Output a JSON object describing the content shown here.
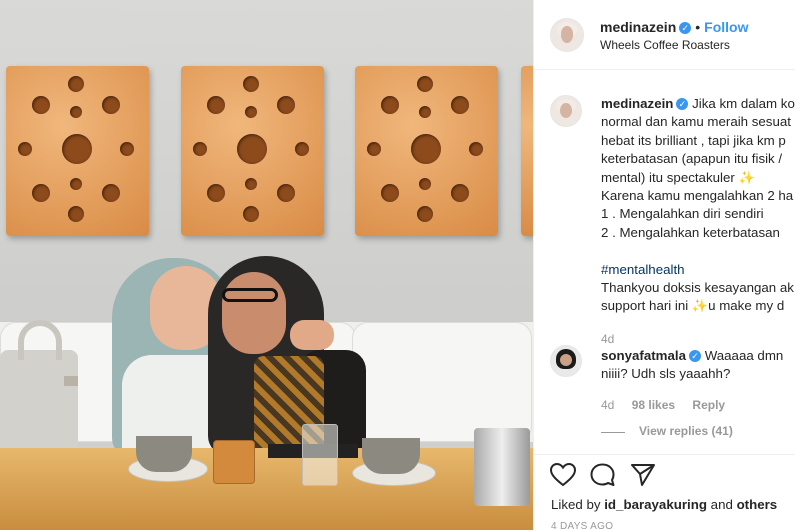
{
  "post": {
    "username": "medinazein",
    "follow_label": "Follow",
    "separator": "•",
    "location": "Wheels Coffee Roasters"
  },
  "caption": {
    "username": "medinazein",
    "lines": [
      "Jika km dalam ko",
      "normal dan kamu meraih sesuat",
      "hebat its brilliant , tapi jika km p",
      "keterbatasan (apapun itu fisik /",
      "mental) itu spectakuler",
      "Karena kamu mengalahkan 2 ha",
      "1 . Mengalahkan diri sendiri",
      "2 . Mengalahkan keterbatasan",
      "",
      "#mentalhealth",
      "Thankyou doksis kesayangan ak",
      "support hari ini",
      "u make my d"
    ],
    "time": "4d"
  },
  "comment": {
    "username": "sonyafatmala",
    "text_line1": "Waaaaa dmn",
    "text_line2": "niiii? Udh sls yaaahh?",
    "time": "4d",
    "likes": "98 likes",
    "reply_label": "Reply",
    "view_replies": "View replies (41)"
  },
  "footer": {
    "liked_by_prefix": "Liked by",
    "liked_by_user": "id_barayakuring",
    "liked_by_and": "and",
    "liked_by_others": "others",
    "time_ago": "4 DAYS AGO"
  },
  "icons": {
    "verified": "verified-badge-icon",
    "like": "heart-icon",
    "comment": "comment-bubble-icon",
    "share": "paper-plane-icon",
    "sparkle": "sparkles-emoji-icon"
  },
  "colors": {
    "link_blue": "#3897f0",
    "hashtag": "#003569",
    "meta_gray": "#999999",
    "text": "#262626"
  }
}
